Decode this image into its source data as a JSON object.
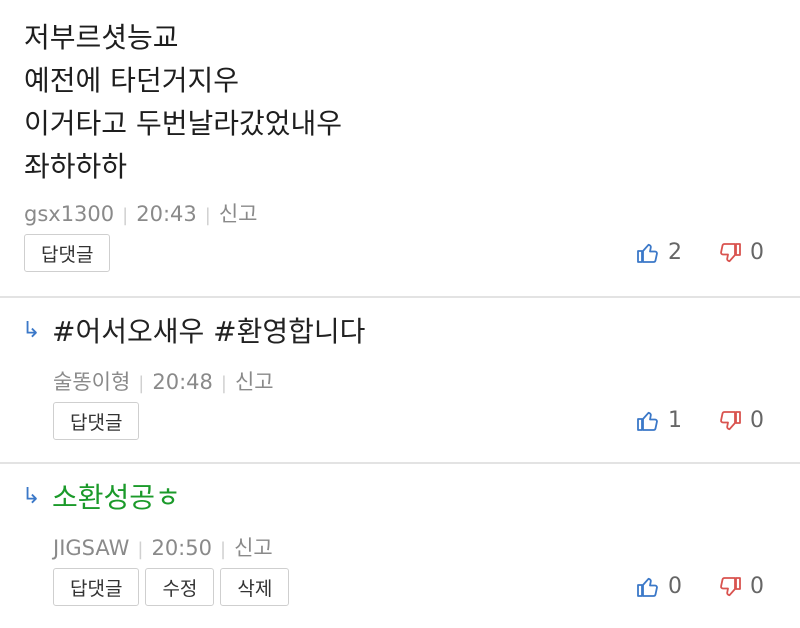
{
  "comments": [
    {
      "lines": [
        "저부르셧능교",
        "예전에 타던거지우",
        "이거타고 두번날라갔었내우",
        "좌하하하"
      ],
      "author": "gsx1300",
      "time": "20:43",
      "report": "신고",
      "buttons": [
        "답댓글"
      ],
      "likes": "2",
      "dislikes": "0"
    },
    {
      "reply_arrow": "↳",
      "text": "#어서오새우 #환영합니다",
      "author": "술똥이형",
      "time": "20:48",
      "report": "신고",
      "buttons": [
        "답댓글"
      ],
      "likes": "1",
      "dislikes": "0"
    },
    {
      "reply_arrow": "↳",
      "text": "소환성공ㅎ",
      "text_color": "#1b9a2a",
      "author": "JIGSAW",
      "time": "20:50",
      "report": "신고",
      "buttons": [
        "답댓글",
        "수정",
        "삭제"
      ],
      "likes": "0",
      "dislikes": "0"
    }
  ],
  "icons": {
    "like": "thumbs-up-icon",
    "dislike": "thumbs-down-icon"
  },
  "colors": {
    "like": "#3b78c8",
    "dislike": "#d9534f",
    "reply_green": "#1b9a2a"
  }
}
